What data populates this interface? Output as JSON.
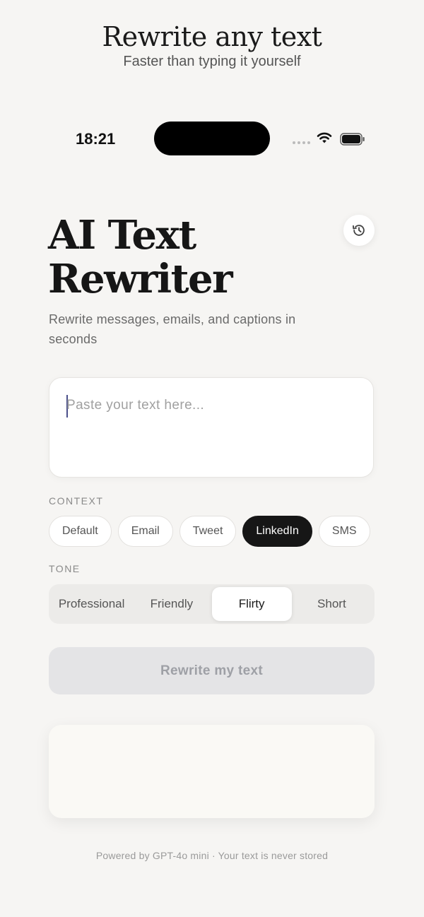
{
  "promo": {
    "title": "Rewrite any text",
    "subtitle": "Faster than typing it yourself"
  },
  "status_bar": {
    "time": "18:21",
    "icons": [
      "signal-dots-icon",
      "wifi-icon",
      "battery-icon"
    ]
  },
  "header": {
    "title_line1": "AI Text",
    "title_line2": "Rewriter",
    "description": "Rewrite messages, emails, and captions in seconds",
    "history_icon": "history-icon"
  },
  "input": {
    "placeholder": "Paste your text here...",
    "value": ""
  },
  "context": {
    "label": "CONTEXT",
    "options": [
      "Default",
      "Email",
      "Tweet",
      "LinkedIn",
      "SMS"
    ],
    "selected": "LinkedIn"
  },
  "tone": {
    "label": "TONE",
    "options": [
      "Professional",
      "Friendly",
      "Flirty",
      "Short"
    ],
    "selected": "Flirty"
  },
  "actions": {
    "rewrite_label": "Rewrite my text"
  },
  "output": {
    "text": ""
  },
  "footer": {
    "note": "Powered by GPT-4o mini · Your text is never stored"
  },
  "colors": {
    "background": "#f6f5f3",
    "active_chip": "#161616",
    "button_disabled": "#e4e4e6",
    "caret": "#4a4f8a"
  }
}
